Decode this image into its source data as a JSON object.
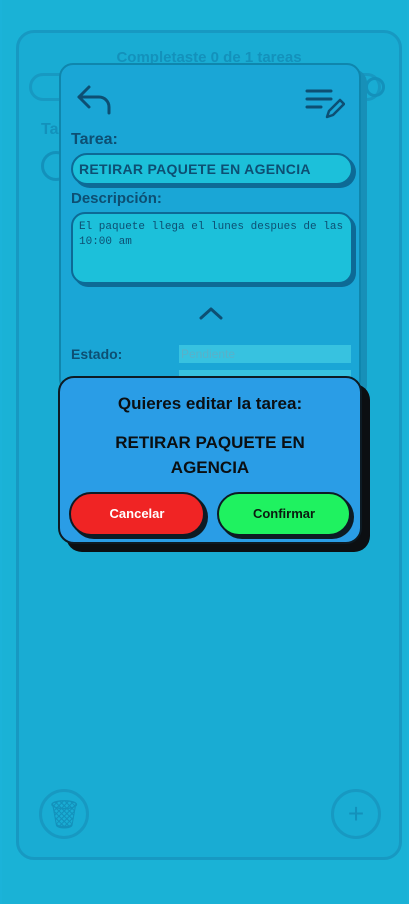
{
  "background": {
    "summary": "Completaste 0 de 1 tareas",
    "section_label": "Ta"
  },
  "edit_card": {
    "task_label": "Tarea:",
    "task_value": "RETIRAR PAQUETE EN AGENCIA",
    "description_label": "Descripción:",
    "description_value": "El paquete llega el lunes despues de las 10:00 am",
    "status_label": "Estado:",
    "status_placeholder": "Pendiente"
  },
  "dialog": {
    "title": "Quieres editar la tarea:",
    "task_name": "RETIRAR PAQUETE EN AGENCIA",
    "cancel_label": "Cancelar",
    "confirm_label": "Confirmar"
  },
  "colors": {
    "cancel": "#f02424",
    "confirm": "#1ff260",
    "dialog_bg": "#2a9de6"
  }
}
